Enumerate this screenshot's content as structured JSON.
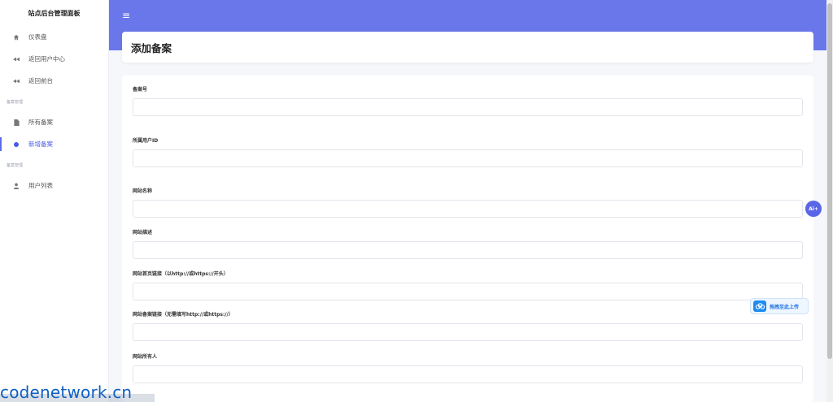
{
  "sidebar": {
    "brand": "站点后台管理面板",
    "items_top": [
      {
        "label": "仪表盘",
        "icon": "home-icon"
      },
      {
        "label": "返回用户中心",
        "icon": "rewind-icon"
      },
      {
        "label": "返回前台",
        "icon": "rewind-icon"
      }
    ],
    "section1": "备案管理",
    "items_mid": [
      {
        "label": "所有备案",
        "icon": "document-icon"
      },
      {
        "label": "新增备案",
        "icon": "circle-icon",
        "active": true
      }
    ],
    "section2": "备案管理",
    "items_bottom": [
      {
        "label": "用户列表",
        "icon": "user-icon"
      }
    ]
  },
  "header": {
    "hamburger": "≡"
  },
  "page": {
    "title": "添加备案"
  },
  "form": {
    "fields": [
      {
        "label": "备案号",
        "value": ""
      },
      {
        "label": "所属用户ID",
        "value": ""
      },
      {
        "label": "网站名称",
        "value": ""
      },
      {
        "label": "网站描述",
        "value": ""
      },
      {
        "label": "网站首页链接（以http://或https://开头）",
        "value": ""
      },
      {
        "label": "网站备案链接（无需填写http://或https://）",
        "value": ""
      },
      {
        "label": "网站所有人",
        "value": ""
      }
    ]
  },
  "widgets": {
    "ai_label": "Ai+",
    "upload_label": "拖拽至此上传"
  },
  "watermark": "codenetwork.cn",
  "colors": {
    "accent": "#6a77ea",
    "active": "#4b5ae6"
  }
}
